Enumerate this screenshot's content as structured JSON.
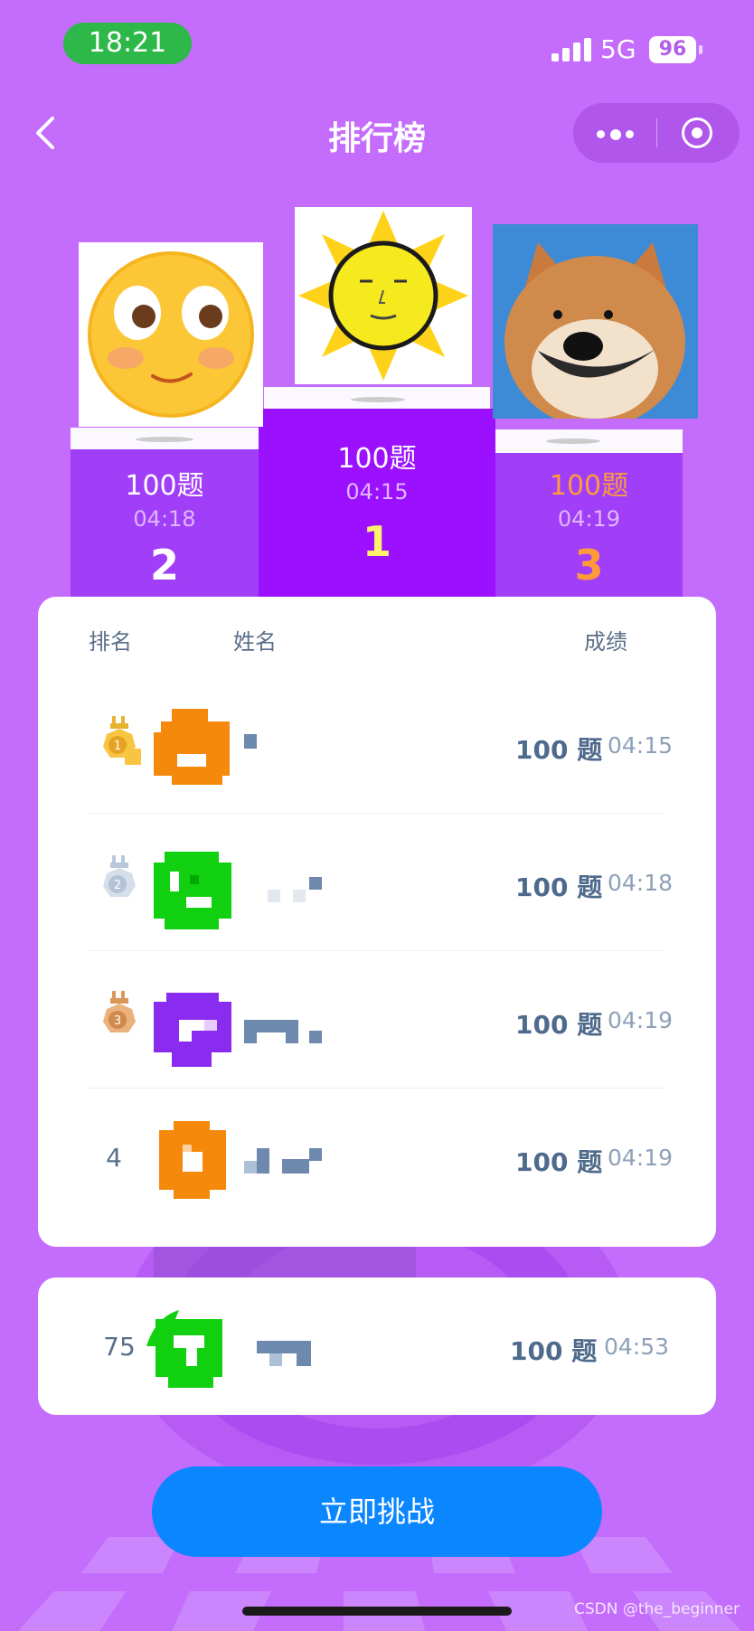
{
  "status_bar": {
    "time": "18:21",
    "network": "5G",
    "battery": "96"
  },
  "nav": {
    "title": "排行榜"
  },
  "podium": [
    {
      "place": "2",
      "count": "100题",
      "time": "04:18"
    },
    {
      "place": "1",
      "count": "100题",
      "time": "04:15"
    },
    {
      "place": "3",
      "count": "100题",
      "time": "04:19"
    }
  ],
  "table": {
    "headers": {
      "rank": "排名",
      "name": "姓名",
      "score": "成绩"
    },
    "rows": [
      {
        "rank": "1",
        "count": "100 题",
        "time": "04:15"
      },
      {
        "rank": "2",
        "count": "100 题",
        "time": "04:18"
      },
      {
        "rank": "3",
        "count": "100 题",
        "time": "04:19"
      },
      {
        "rank": "4",
        "count": "100 题",
        "time": "04:19"
      }
    ]
  },
  "my_rank": {
    "rank": "75",
    "count": "100 题",
    "time": "04:53"
  },
  "button": {
    "label": "立即挑战"
  },
  "watermark": "CSDN @the_beginner",
  "colors": {
    "background": "#c46cfb",
    "podium": "#a03ff7",
    "podium_center": "#9a10ff",
    "gold_text": "#fff36b",
    "bronze_text": "#ff9a3c",
    "button": "#0a86ff",
    "text": "#4e6a8c"
  }
}
